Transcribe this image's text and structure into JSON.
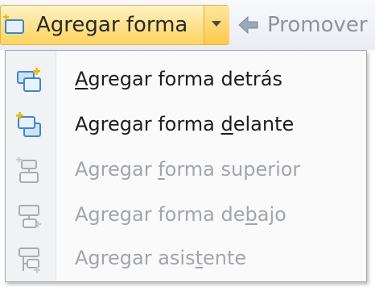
{
  "toolbar": {
    "add_shape_label": "Agregar forma",
    "promote_label": "Promover"
  },
  "menu": {
    "items": [
      {
        "pre": "",
        "key": "A",
        "post": "gregar forma detrás",
        "enabled": true,
        "icon": "add-shape-behind-icon"
      },
      {
        "pre": "Agregar forma ",
        "key": "d",
        "post": "elante",
        "enabled": true,
        "icon": "add-shape-in-front-icon"
      },
      {
        "pre": "Agregar ",
        "key": "f",
        "post": "orma superior",
        "enabled": false,
        "icon": "add-shape-above-icon"
      },
      {
        "pre": "Agregar forma de",
        "key": "b",
        "post": "ajo",
        "enabled": false,
        "icon": "add-shape-below-icon"
      },
      {
        "pre": "Agregar asis",
        "key": "t",
        "post": "ente",
        "enabled": false,
        "icon": "add-assistant-icon"
      }
    ]
  },
  "colors": {
    "highlight": "#ffd560",
    "menu_text": "#1d1d1d",
    "disabled_text": "#a2a5a9",
    "icon_blue": "#3d87c9"
  }
}
